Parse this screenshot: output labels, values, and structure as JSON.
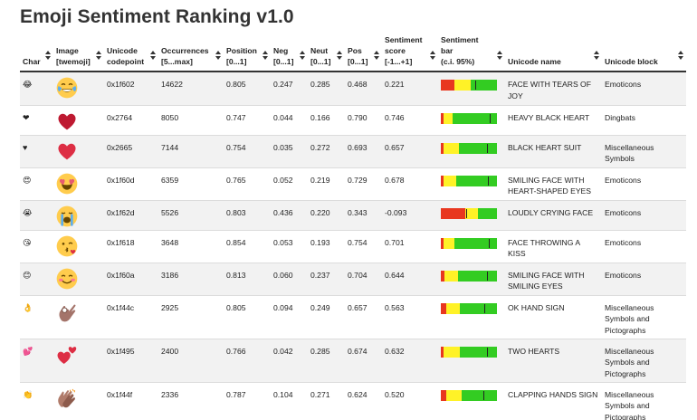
{
  "title": "Emoji Sentiment Ranking v1.0",
  "columns": [
    {
      "line1": "",
      "line2": "Char"
    },
    {
      "line1": "Image",
      "line2": "[twemoji]"
    },
    {
      "line1": "Unicode",
      "line2": "codepoint"
    },
    {
      "line1": "Occurrences",
      "line2": "[5...max]"
    },
    {
      "line1": "Position",
      "line2": "[0...1]"
    },
    {
      "line1": "Neg",
      "line2": "[0...1]"
    },
    {
      "line1": "Neut",
      "line2": "[0...1]"
    },
    {
      "line1": "Pos",
      "line2": "[0...1]"
    },
    {
      "line1": "Sentiment",
      "line2": "score",
      "line3": "[-1...+1]"
    },
    {
      "line1": "Sentiment",
      "line2": "bar",
      "line3": "(c.i. 95%)"
    },
    {
      "line1": "",
      "line2": "Unicode name"
    },
    {
      "line1": "",
      "line2": "Unicode block"
    }
  ],
  "rows": [
    {
      "char": "😂",
      "icon": "face-with-tears-of-joy-icon",
      "codepoint": "0x1f602",
      "occurrences": "14622",
      "position": "0.805",
      "neg": "0.247",
      "neut": "0.285",
      "pos": "0.468",
      "score": "0.221",
      "bar": {
        "red": 0.247,
        "yellow": 0.285,
        "green": 0.468,
        "mark": 0.61
      },
      "name": "FACE WITH TEARS OF JOY",
      "block": "Emoticons"
    },
    {
      "char": "❤",
      "icon": "heavy-black-heart-icon",
      "codepoint": "0x2764",
      "occurrences": "8050",
      "position": "0.747",
      "neg": "0.044",
      "neut": "0.166",
      "pos": "0.790",
      "score": "0.746",
      "bar": {
        "red": 0.044,
        "yellow": 0.166,
        "green": 0.79,
        "mark": 0.87
      },
      "name": "HEAVY BLACK HEART",
      "block": "Dingbats"
    },
    {
      "char": "♥",
      "icon": "black-heart-suit-icon",
      "codepoint": "0x2665",
      "occurrences": "7144",
      "position": "0.754",
      "neg": "0.035",
      "neut": "0.272",
      "pos": "0.693",
      "score": "0.657",
      "bar": {
        "red": 0.035,
        "yellow": 0.272,
        "green": 0.693,
        "mark": 0.83
      },
      "name": "BLACK HEART SUIT",
      "block": "Miscellaneous Symbols"
    },
    {
      "char": "😍",
      "icon": "smiling-face-with-heart-eyes-icon",
      "codepoint": "0x1f60d",
      "occurrences": "6359",
      "position": "0.765",
      "neg": "0.052",
      "neut": "0.219",
      "pos": "0.729",
      "score": "0.678",
      "bar": {
        "red": 0.052,
        "yellow": 0.219,
        "green": 0.729,
        "mark": 0.84
      },
      "name": "SMILING FACE WITH HEART-SHAPED EYES",
      "block": "Emoticons"
    },
    {
      "char": "😭",
      "icon": "loudly-crying-face-icon",
      "codepoint": "0x1f62d",
      "occurrences": "5526",
      "position": "0.803",
      "neg": "0.436",
      "neut": "0.220",
      "pos": "0.343",
      "score": "-0.093",
      "bar": {
        "red": 0.436,
        "yellow": 0.22,
        "green": 0.343,
        "mark": 0.45
      },
      "name": "LOUDLY CRYING FACE",
      "block": "Emoticons"
    },
    {
      "char": "😘",
      "icon": "face-throwing-a-kiss-icon",
      "codepoint": "0x1f618",
      "occurrences": "3648",
      "position": "0.854",
      "neg": "0.053",
      "neut": "0.193",
      "pos": "0.754",
      "score": "0.701",
      "bar": {
        "red": 0.053,
        "yellow": 0.193,
        "green": 0.754,
        "mark": 0.85
      },
      "name": "FACE THROWING A KISS",
      "block": "Emoticons"
    },
    {
      "char": "😊",
      "icon": "smiling-face-with-smiling-eyes-icon",
      "codepoint": "0x1f60a",
      "occurrences": "3186",
      "position": "0.813",
      "neg": "0.060",
      "neut": "0.237",
      "pos": "0.704",
      "score": "0.644",
      "bar": {
        "red": 0.06,
        "yellow": 0.237,
        "green": 0.704,
        "mark": 0.82
      },
      "name": "SMILING FACE WITH SMILING EYES",
      "block": "Emoticons"
    },
    {
      "char": "👌",
      "icon": "ok-hand-sign-icon",
      "codepoint": "0x1f44c",
      "occurrences": "2925",
      "position": "0.805",
      "neg": "0.094",
      "neut": "0.249",
      "pos": "0.657",
      "score": "0.563",
      "bar": {
        "red": 0.094,
        "yellow": 0.249,
        "green": 0.657,
        "mark": 0.78
      },
      "name": "OK HAND SIGN",
      "block": "Miscellaneous Symbols and Pictographs"
    },
    {
      "char": "💕",
      "icon": "two-hearts-icon",
      "codepoint": "0x1f495",
      "occurrences": "2400",
      "position": "0.766",
      "neg": "0.042",
      "neut": "0.285",
      "pos": "0.674",
      "score": "0.632",
      "bar": {
        "red": 0.042,
        "yellow": 0.285,
        "green": 0.674,
        "mark": 0.82
      },
      "name": "TWO HEARTS",
      "block": "Miscellaneous Symbols and Pictographs"
    },
    {
      "char": "👏",
      "icon": "clapping-hands-sign-icon",
      "codepoint": "0x1f44f",
      "occurrences": "2336",
      "position": "0.787",
      "neg": "0.104",
      "neut": "0.271",
      "pos": "0.624",
      "score": "0.520",
      "bar": {
        "red": 0.104,
        "yellow": 0.271,
        "green": 0.624,
        "mark": 0.76
      },
      "name": "CLAPPING HANDS SIGN",
      "block": "Miscellaneous Symbols and Pictographs"
    }
  ]
}
